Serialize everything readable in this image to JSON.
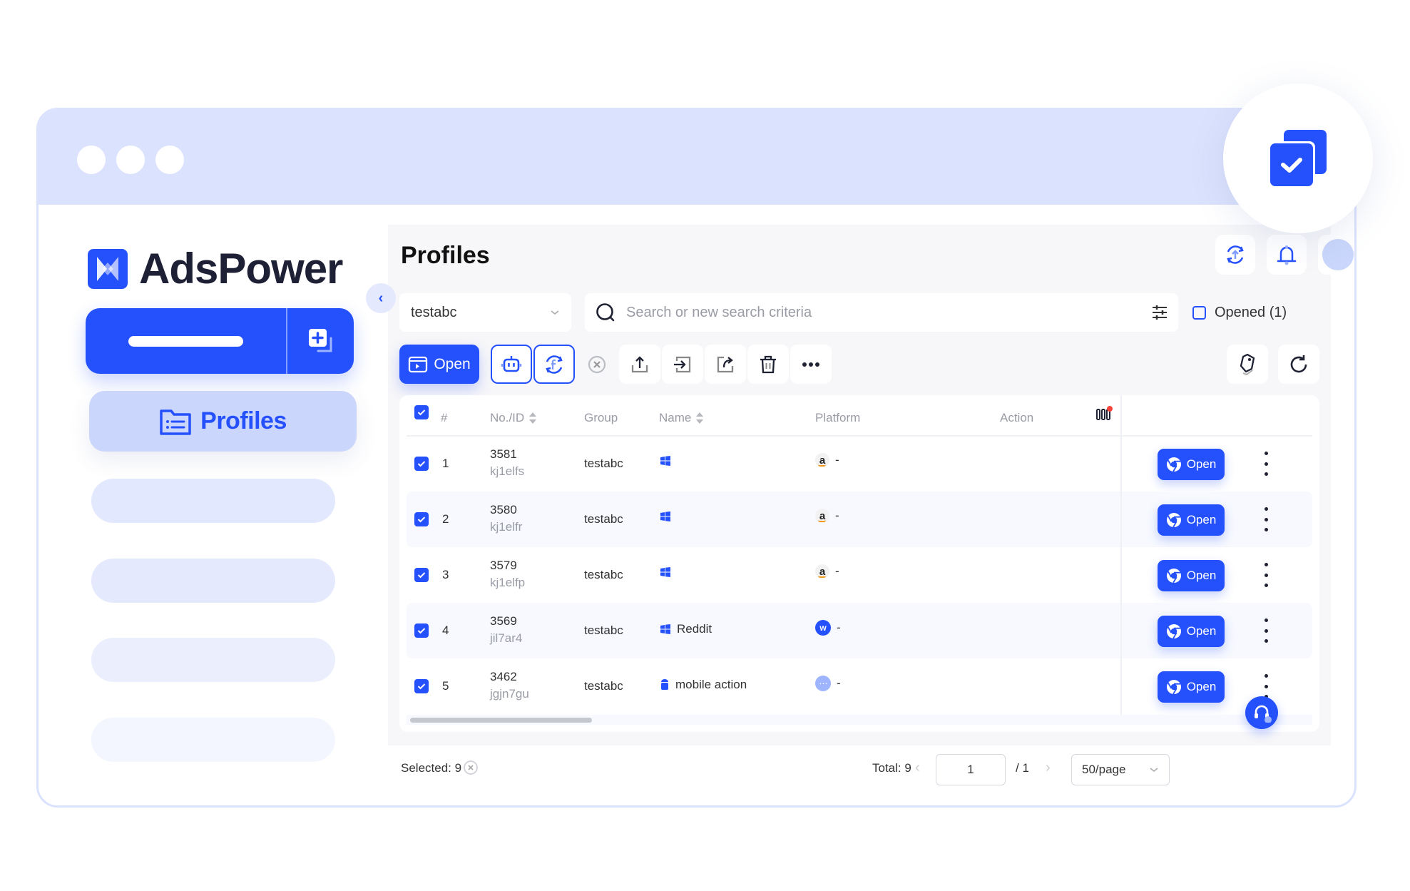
{
  "brand": {
    "name": "AdsPower",
    "color": "#2551fd"
  },
  "window": {
    "controls": [
      "dot",
      "dot",
      "dot"
    ]
  },
  "sidebar": {
    "new_profile_button": {
      "icon": "add-profile-icon"
    },
    "items": [
      {
        "label": "Profiles",
        "icon": "folder-list-icon",
        "active": true
      }
    ],
    "placeholders": 4
  },
  "header": {
    "title": "Profiles",
    "icons": [
      "sync-upload-icon",
      "bell-icon",
      "avatar"
    ]
  },
  "filters": {
    "group": "testabc",
    "search_placeholder": "Search or new search criteria",
    "opened_label": "Opened (1)"
  },
  "toolbar": {
    "open_label": "Open",
    "icons": [
      "robot-icon",
      "facebook-sync-icon",
      "close-circle-icon",
      "upload-icon",
      "import-icon",
      "share-icon",
      "trash-icon",
      "more-icon"
    ],
    "right_icons": [
      "tag-icon",
      "refresh-icon"
    ]
  },
  "table": {
    "columns": {
      "index": "#",
      "id": "No./ID",
      "group": "Group",
      "name": "Name",
      "platform": "Platform",
      "action": "Action"
    },
    "rows": [
      {
        "index": "1",
        "no": "3581",
        "id": "kj1elfs",
        "group": "testabc",
        "os": "windows",
        "name": "",
        "platform": "amazon",
        "platform_text": "-",
        "action": "Open"
      },
      {
        "index": "2",
        "no": "3580",
        "id": "kj1elfr",
        "group": "testabc",
        "os": "windows",
        "name": "",
        "platform": "amazon",
        "platform_text": "-",
        "action": "Open"
      },
      {
        "index": "3",
        "no": "3579",
        "id": "kj1elfp",
        "group": "testabc",
        "os": "windows",
        "name": "",
        "platform": "amazon",
        "platform_text": "-",
        "action": "Open"
      },
      {
        "index": "4",
        "no": "3569",
        "id": "jil7ar4",
        "group": "testabc",
        "os": "windows",
        "name": "Reddit",
        "platform": "w",
        "platform_text": "-",
        "action": "Open"
      },
      {
        "index": "5",
        "no": "3462",
        "id": "jgjn7gu",
        "group": "testabc",
        "os": "android",
        "name": "mobile action",
        "platform": "other",
        "platform_text": "-",
        "action": "Open"
      }
    ]
  },
  "footer": {
    "selected": "Selected: 9",
    "total": "Total: 9",
    "page": "1",
    "page_total": "/ 1",
    "per_page": "50/page"
  }
}
